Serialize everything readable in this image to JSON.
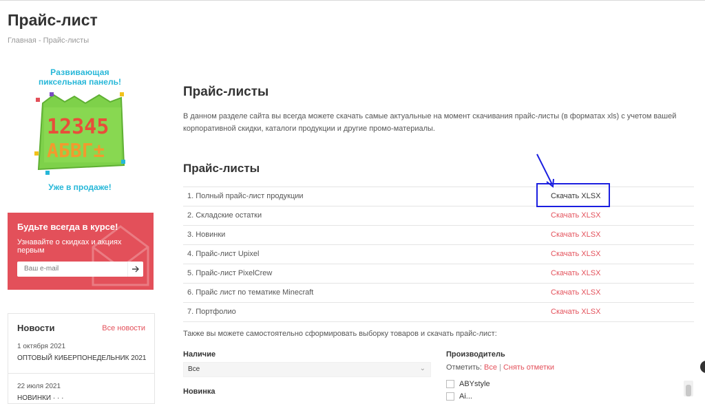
{
  "page": {
    "title": "Прайс-лист",
    "breadcrumb": {
      "home": "Главная",
      "sep": "-",
      "current": "Прайс-листы"
    }
  },
  "promo": {
    "line1": "Развивающая",
    "line2": "пиксельная панель!",
    "bottom": "Уже в продаже!",
    "board_text1": "12345",
    "board_text2": "АБВГ±"
  },
  "subscribe": {
    "title": "Будьте всегда в курсе!",
    "text": "Узнавайте о скидках и акциях первым",
    "placeholder": "Ваш e-mail"
  },
  "news": {
    "title": "Новости",
    "all_link": "Все новости",
    "items": [
      {
        "date": "1 октября 2021",
        "headline": "ОПТОВЫЙ КИБЕРПОНЕДЕЛЬНИК 2021"
      },
      {
        "date": "22 июля 2021",
        "headline": "НОВИНКИ · · ·"
      }
    ]
  },
  "main": {
    "heading": "Прайс-листы",
    "intro": "В данном разделе сайта вы всегда можете скачать самые актуальные на момент скачивания прайс-листы (в форматах xls) с учетом вашей корпоративной скидки, каталоги продукции и другие промо-материалы.",
    "subheading": "Прайс-листы",
    "pricelists": [
      {
        "name": "1. Полный прайс-лист продукции",
        "link": "Скачать XLSX"
      },
      {
        "name": "2. Складские остатки",
        "link": "Скачать XLSX"
      },
      {
        "name": "3. Новинки",
        "link": "Скачать XLSX"
      },
      {
        "name": "4. Прайс-лист Upixel",
        "link": "Скачать XLSX"
      },
      {
        "name": "5. Прайс-лист PixelCrew",
        "link": "Скачать XLSX"
      },
      {
        "name": "6. Прайс лист по тематике Minecraft",
        "link": "Скачать XLSX"
      },
      {
        "name": "7. Портфолио",
        "link": "Скачать XLSX"
      }
    ],
    "also_text": "Также вы можете самостоятельно сформировать выборку товаров и скачать прайс-лист:"
  },
  "filters": {
    "availability_label": "Наличие",
    "availability_value": "Все",
    "novelty_label": "Новинка",
    "manufacturer_label": "Производитель",
    "mark_prefix": "Отметить:",
    "mark_all": "Все",
    "mark_sep": "|",
    "mark_none": "Снять отметки",
    "manufacturers": [
      "ABYstyle",
      "Ai..."
    ]
  },
  "colors": {
    "accent": "#e3505a",
    "highlight": "#1a1ee0",
    "promo": "#26b7d8"
  }
}
